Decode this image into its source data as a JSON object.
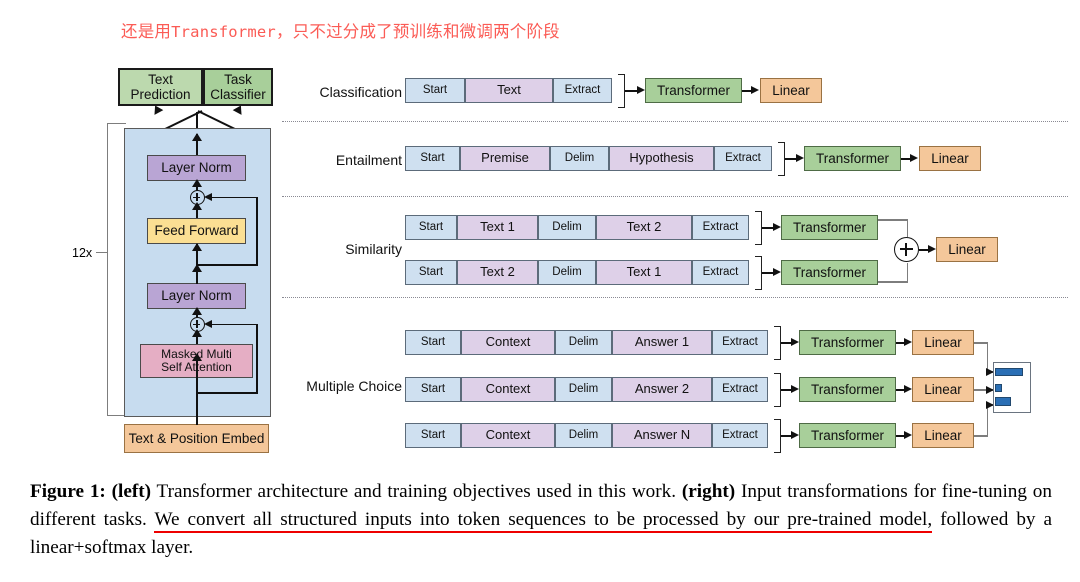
{
  "annotation": {
    "zh_note_pre": "还是用",
    "zh_note_mono": "Transformer",
    "zh_note_post": "，只不过分成了预训练和微调两个阶段",
    "color": "#fb5b55"
  },
  "architecture": {
    "heads": [
      {
        "label": "Text\nPrediction",
        "line1": "Text",
        "line2": "Prediction",
        "color": "#bcd9ae"
      },
      {
        "label": "Task\nClassifier",
        "line1": "Task",
        "line2": "Classifier",
        "color": "#a8cf9a"
      }
    ],
    "blocks": [
      {
        "name": "layer-norm-top",
        "label": "Layer Norm",
        "color": "#b9a5d4"
      },
      {
        "name": "feed-forward",
        "label": "Feed Forward",
        "color": "#fbdf93"
      },
      {
        "name": "layer-norm-bottom",
        "label": "Layer Norm",
        "color": "#b9a5d4"
      },
      {
        "name": "masked-multi-self-attention",
        "line1": "Masked Multi",
        "line2": "Self Attention",
        "color": "#e5aec4"
      }
    ],
    "embed": {
      "label": "Text & Position Embed",
      "color": "#f4c79a"
    },
    "repeat_label": "12x",
    "panel_color": "#c7dcef",
    "residual_symbol": "+"
  },
  "tasks": [
    {
      "name": "classification",
      "label": "Classification",
      "sequences": [
        {
          "tokens": [
            {
              "text": "Start",
              "type": "special"
            },
            {
              "text": "Text",
              "type": "content"
            },
            {
              "text": "Extract",
              "type": "special"
            }
          ]
        }
      ],
      "transformer_label": "Transformer",
      "linear_label": "Linear"
    },
    {
      "name": "entailment",
      "label": "Entailment",
      "sequences": [
        {
          "tokens": [
            {
              "text": "Start",
              "type": "special"
            },
            {
              "text": "Premise",
              "type": "content"
            },
            {
              "text": "Delim",
              "type": "special"
            },
            {
              "text": "Hypothesis",
              "type": "content"
            },
            {
              "text": "Extract",
              "type": "special"
            }
          ]
        }
      ],
      "transformer_label": "Transformer",
      "linear_label": "Linear"
    },
    {
      "name": "similarity",
      "label": "Similarity",
      "sequences": [
        {
          "tokens": [
            {
              "text": "Start",
              "type": "special"
            },
            {
              "text": "Text 1",
              "type": "content"
            },
            {
              "text": "Delim",
              "type": "special"
            },
            {
              "text": "Text 2",
              "type": "content"
            },
            {
              "text": "Extract",
              "type": "special"
            }
          ]
        },
        {
          "tokens": [
            {
              "text": "Start",
              "type": "special"
            },
            {
              "text": "Text 2",
              "type": "content"
            },
            {
              "text": "Delim",
              "type": "special"
            },
            {
              "text": "Text 1",
              "type": "content"
            },
            {
              "text": "Extract",
              "type": "special"
            }
          ]
        }
      ],
      "transformer_label": "Transformer",
      "merge_symbol": "+",
      "linear_label": "Linear"
    },
    {
      "name": "multiple-choice",
      "label": "Multiple Choice",
      "sequences": [
        {
          "tokens": [
            {
              "text": "Start",
              "type": "special"
            },
            {
              "text": "Context",
              "type": "content"
            },
            {
              "text": "Delim",
              "type": "special"
            },
            {
              "text": "Answer 1",
              "type": "content"
            },
            {
              "text": "Extract",
              "type": "special"
            }
          ]
        },
        {
          "tokens": [
            {
              "text": "Start",
              "type": "special"
            },
            {
              "text": "Context",
              "type": "content"
            },
            {
              "text": "Delim",
              "type": "special"
            },
            {
              "text": "Answer 2",
              "type": "content"
            },
            {
              "text": "Extract",
              "type": "special"
            }
          ]
        },
        {
          "tokens": [
            {
              "text": "Start",
              "type": "special"
            },
            {
              "text": "Context",
              "type": "content"
            },
            {
              "text": "Delim",
              "type": "special"
            },
            {
              "text": "Answer N",
              "type": "content"
            },
            {
              "text": "Extract",
              "type": "special"
            }
          ]
        }
      ],
      "transformer_label": "Transformer",
      "linear_label": "Linear",
      "output_bars": [
        28,
        7,
        16
      ]
    }
  ],
  "caption": {
    "figure_tag": "Figure 1:",
    "left_tag": "(left)",
    "part1": " Transformer architecture and training objectives used in this work. ",
    "right_tag": "(right)",
    "part2": " Input transformations for fine-tuning on different tasks. ",
    "highlight": "We convert all structured inputs into token sequences to be processed by our pre-trained model,",
    "part3": " followed by a linear+softmax layer."
  },
  "colors": {
    "token_special": "#cfe0f0",
    "token_content": "#ded0e8",
    "transformer": "#a8cf9a",
    "linear": "#f4c79a",
    "panel": "#c7dcef",
    "underline": "#ee0000"
  }
}
